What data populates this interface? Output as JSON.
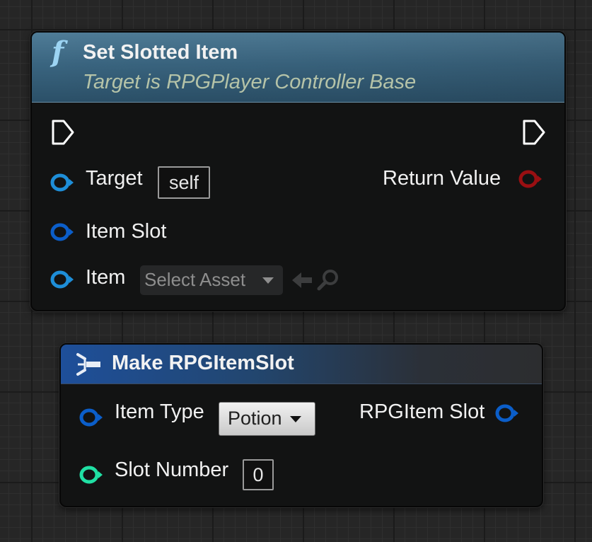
{
  "set_slotted_item": {
    "title": "Set Slotted Item",
    "subtitle": "Target is RPGPlayer Controller Base",
    "icon": "function-icon",
    "pins": {
      "target": {
        "label": "Target",
        "default": "self"
      },
      "item_slot": {
        "label": "Item Slot"
      },
      "item": {
        "label": "Item",
        "asset_placeholder": "Select Asset"
      },
      "return_value": {
        "label": "Return Value"
      }
    }
  },
  "make_rpg_item_slot": {
    "title": "Make RPGItemSlot",
    "icon": "make-struct-icon",
    "pins": {
      "item_type": {
        "label": "Item Type",
        "value": "Potion"
      },
      "slot_number": {
        "label": "Slot Number",
        "value": "0"
      },
      "output": {
        "label": "RPGItem Slot"
      }
    }
  },
  "colors": {
    "object_pin": "#1e8ed8",
    "struct_pin": "#0b5ec9",
    "int_pin": "#20e0a4",
    "bool_pin": "#9a0f12",
    "exec_pin": "#ffffff"
  }
}
